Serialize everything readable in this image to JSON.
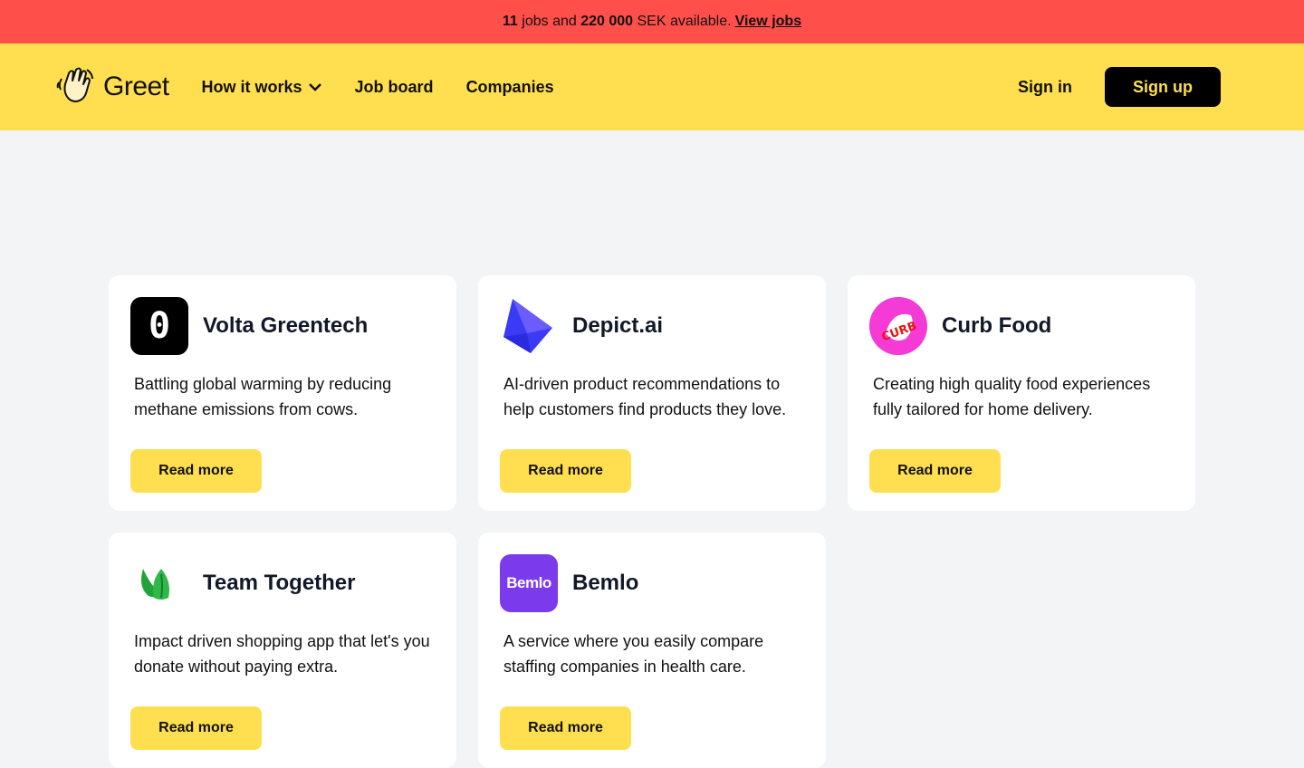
{
  "banner": {
    "jobs_count": "11",
    "text_mid": " jobs and ",
    "amount": "220 000",
    "text_end": " SEK available.",
    "link": "View jobs"
  },
  "nav": {
    "brand": "Greet",
    "menu": [
      "How it works",
      "Job board",
      "Companies"
    ],
    "sign_in": "Sign in",
    "sign_up": "Sign up"
  },
  "companies": [
    {
      "name": "Volta Greentech",
      "desc": "Battling global warming by reducing methane emissions from cows.",
      "button": "Read more",
      "logo_text": "0"
    },
    {
      "name": "Depict.ai",
      "desc": "AI-driven product recommendations to help customers find products they love.",
      "button": "Read more"
    },
    {
      "name": "Curb Food",
      "desc": "Creating high quality food experiences fully tailored for home delivery.",
      "button": "Read more",
      "logo_text": "CURB"
    },
    {
      "name": "Team Together",
      "desc": "Impact driven shopping app that let's you donate without paying extra.",
      "button": "Read more"
    },
    {
      "name": "Bemlo",
      "desc": "A service where you easily compare staffing companies in health care.",
      "button": "Read more",
      "logo_text": "Bemlo"
    }
  ],
  "colors": {
    "banner": "#ff4f4b",
    "brand_yellow": "#ffdf4f",
    "background": "#f3f4f6"
  }
}
